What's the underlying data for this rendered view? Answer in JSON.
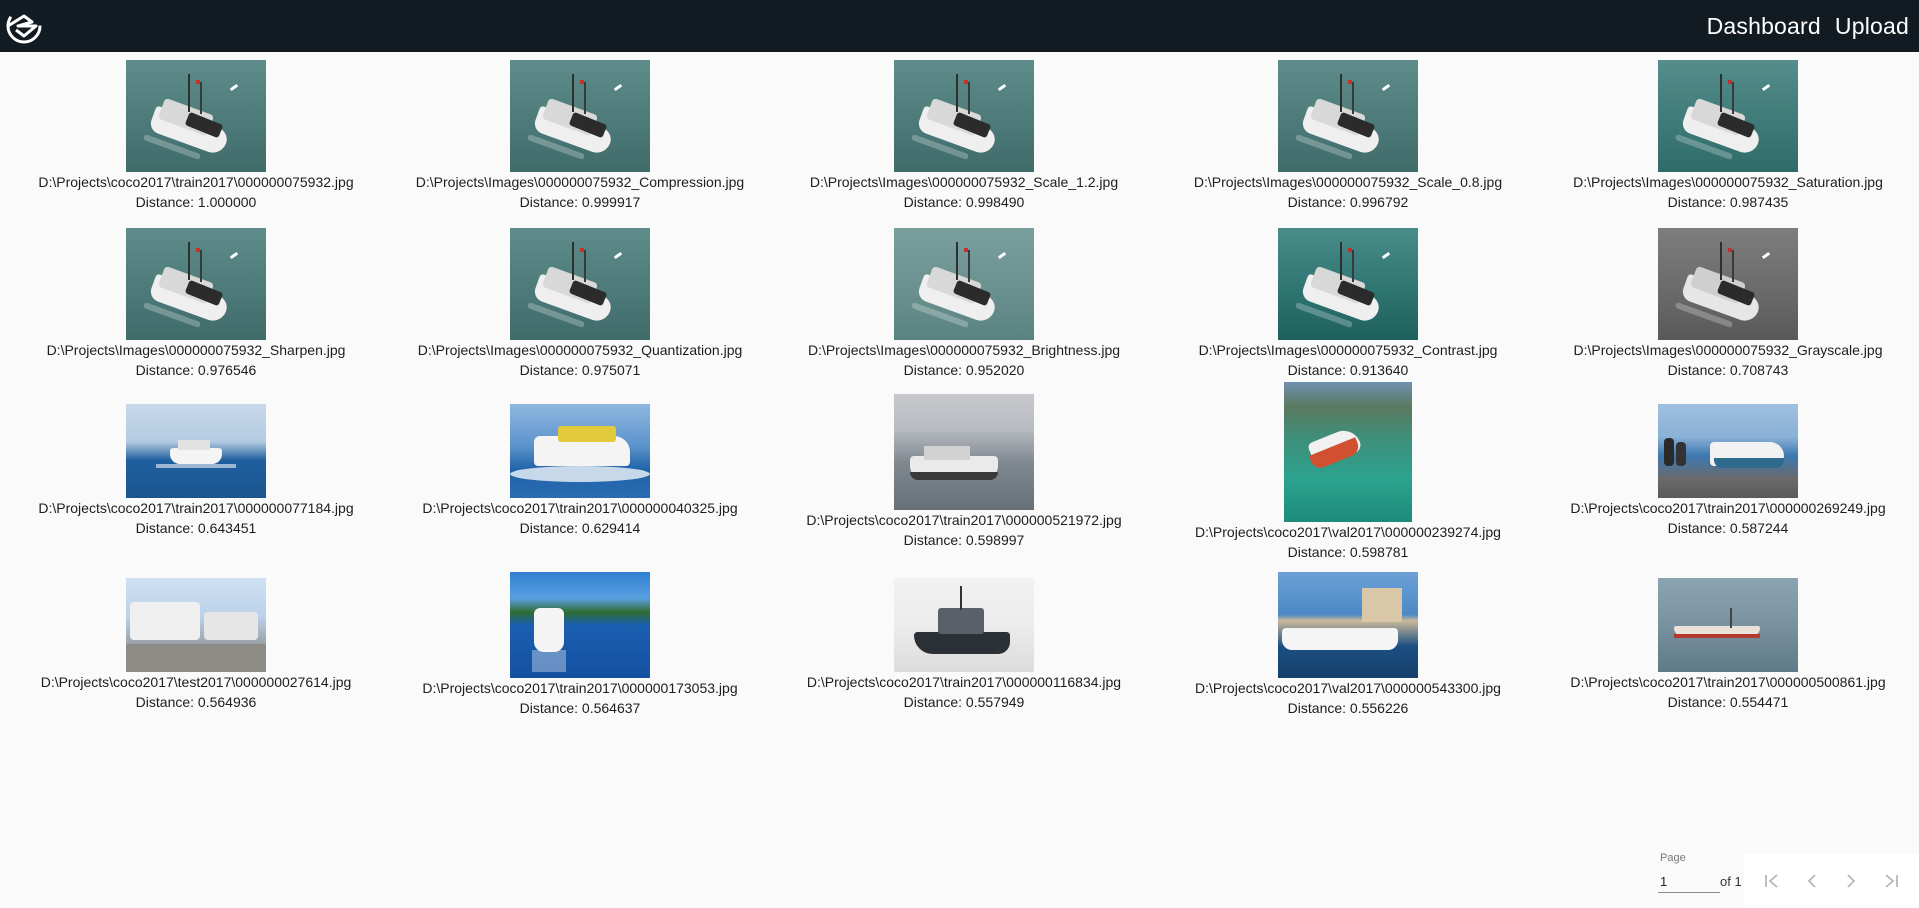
{
  "header": {
    "nav": [
      "Dashboard",
      "Upload"
    ]
  },
  "rows": [
    {
      "items": [
        {
          "path": "D:\\Projects\\coco2017\\train2017\\000000075932.jpg",
          "distance": "Distance: 1.000000",
          "style": "sea"
        },
        {
          "path": "D:\\Projects\\Images\\000000075932_Compression.jpg",
          "distance": "Distance: 0.999917",
          "style": "sea"
        },
        {
          "path": "D:\\Projects\\Images\\000000075932_Scale_1.2.jpg",
          "distance": "Distance: 0.998490",
          "style": "sea"
        },
        {
          "path": "D:\\Projects\\Images\\000000075932_Scale_0.8.jpg",
          "distance": "Distance: 0.996792",
          "style": "sea"
        },
        {
          "path": "D:\\Projects\\Images\\000000075932_Saturation.jpg",
          "distance": "Distance: 0.987435",
          "style": "sea sat"
        }
      ]
    },
    {
      "items": [
        {
          "path": "D:\\Projects\\Images\\000000075932_Sharpen.jpg",
          "distance": "Distance: 0.976546",
          "style": "sea"
        },
        {
          "path": "D:\\Projects\\Images\\000000075932_Quantization.jpg",
          "distance": "Distance: 0.975071",
          "style": "sea"
        },
        {
          "path": "D:\\Projects\\Images\\000000075932_Brightness.jpg",
          "distance": "Distance: 0.952020",
          "style": "sea bright"
        },
        {
          "path": "D:\\Projects\\Images\\000000075932_Contrast.jpg",
          "distance": "Distance: 0.913640",
          "style": "sea contrast"
        },
        {
          "path": "D:\\Projects\\Images\\000000075932_Grayscale.jpg",
          "distance": "Distance: 0.708743",
          "style": "sea gray"
        }
      ]
    },
    {
      "items": [
        {
          "path": "D:\\Projects\\coco2017\\train2017\\000000077184.jpg",
          "distance": "Distance: 0.643451",
          "style": "photo-a"
        },
        {
          "path": "D:\\Projects\\coco2017\\train2017\\000000040325.jpg",
          "distance": "Distance: 0.629414",
          "style": "photo-b"
        },
        {
          "path": "D:\\Projects\\coco2017\\train2017\\000000521972.jpg",
          "distance": "Distance: 0.598997",
          "style": "photo-c"
        },
        {
          "path": "D:\\Projects\\coco2017\\val2017\\000000239274.jpg",
          "distance": "Distance: 0.598781",
          "style": "photo-d"
        },
        {
          "path": "D:\\Projects\\coco2017\\train2017\\000000269249.jpg",
          "distance": "Distance: 0.587244",
          "style": "photo-e"
        }
      ]
    },
    {
      "items": [
        {
          "path": "D:\\Projects\\coco2017\\test2017\\000000027614.jpg",
          "distance": "Distance: 0.564936",
          "style": "photo-f"
        },
        {
          "path": "D:\\Projects\\coco2017\\train2017\\000000173053.jpg",
          "distance": "Distance: 0.564637",
          "style": "photo-g"
        },
        {
          "path": "D:\\Projects\\coco2017\\train2017\\000000116834.jpg",
          "distance": "Distance: 0.557949",
          "style": "photo-h"
        },
        {
          "path": "D:\\Projects\\coco2017\\val2017\\000000543300.jpg",
          "distance": "Distance: 0.556226",
          "style": "photo-i"
        },
        {
          "path": "D:\\Projects\\coco2017\\train2017\\000000500861.jpg",
          "distance": "Distance: 0.554471",
          "style": "photo-j"
        }
      ]
    }
  ],
  "pager": {
    "label": "Page",
    "value": "1",
    "of": "of 1"
  },
  "icons": {
    "logo": "logo-icon",
    "first": "first-page-icon",
    "prev": "chevron-left-icon",
    "next": "chevron-right-icon",
    "last": "last-page-icon"
  },
  "colors": {
    "header_bg": "#131b22",
    "page_bg": "#fafafa"
  }
}
